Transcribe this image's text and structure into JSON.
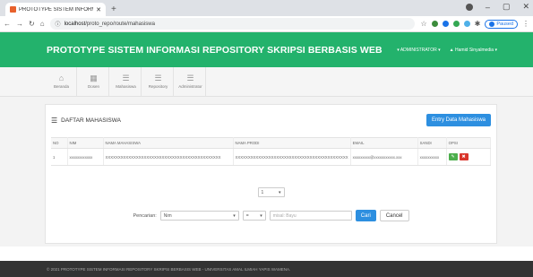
{
  "browser": {
    "tab_title": "PROTOTYPE SISTEM INFORMASI",
    "url_host": "localhost",
    "url_path": "/proto_repo/route/mahasiswa",
    "profile_label": "Paused"
  },
  "header": {
    "title": "PROTOTYPE SISTEM INFORMASI REPOSITORY SKRIPSI BERBASIS WEB",
    "role_menu": "ADMINISTRATOR",
    "user_menu": "Hamid Sinyalmedia"
  },
  "nav": [
    {
      "label": "Beranda",
      "icon": "home-icon"
    },
    {
      "label": "Dosen",
      "icon": "calendar-icon"
    },
    {
      "label": "Mahasiswa",
      "icon": "list-icon"
    },
    {
      "label": "Repository",
      "icon": "list-icon"
    },
    {
      "label": "Administrator",
      "icon": "list-icon"
    }
  ],
  "panel": {
    "title": "DAFTAR MAHASISWA",
    "entry_button": "Entry Data Mahasiswa"
  },
  "table": {
    "headers": [
      "NO",
      "NIM",
      "NAMA MAHASISWA",
      "NAMA PRODI",
      "EMAIL",
      "SANDI",
      "OPSI"
    ],
    "rows": [
      [
        "1",
        "xxxxxxxxxxxx",
        "XXXXXXXXXXXXXXXXXXXXXXXXXXXXXXXXXXXXXXXXXXXXX",
        "XXXXXXXXXXXXXXXXXXXXXXXXXXXXXXXXXXXXXXXXXXXX",
        "xxxxxxxxx@xxxxxxxxxxx.xxx",
        "xxxxxxxxxx"
      ]
    ]
  },
  "pager": {
    "value": "1"
  },
  "search": {
    "label": "Pencarian:",
    "field_value": "Nim",
    "operator_value": "=",
    "input_placeholder": "misal: Bayu",
    "search_button": "Cari",
    "cancel_button": "Cancel"
  },
  "footer": {
    "text": "© 2021 PROTOTYPE SISTEM INFORMASI REPOSITORY SKRIPSI BERBASIS WEB - UNIVERSITAS AMAL ILMIAH YAPIS WAMENA."
  },
  "colors": {
    "header_green": "#23b26c",
    "primary_blue": "#2d8fe0",
    "edit_green": "#4cae4c",
    "delete_red": "#d9362c"
  }
}
